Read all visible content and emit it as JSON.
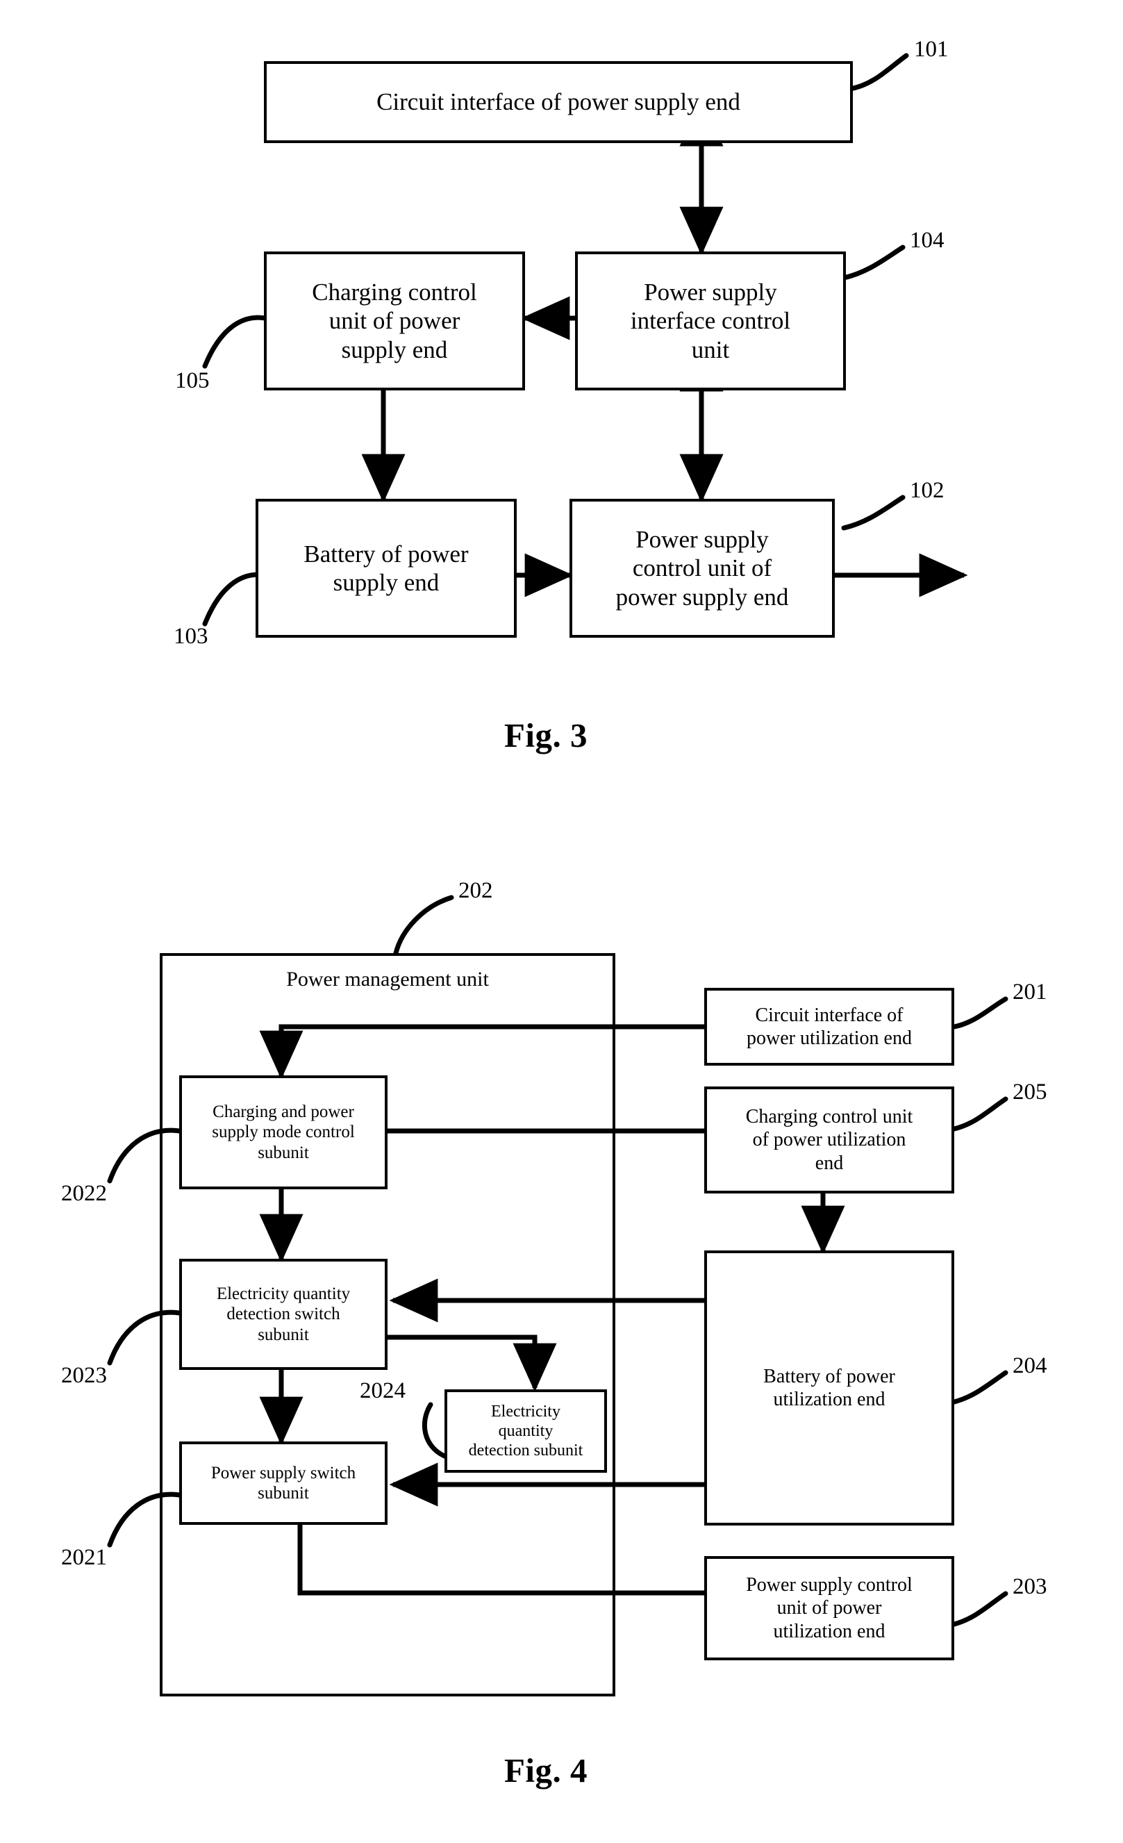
{
  "figure3": {
    "caption": "Fig. 3",
    "boxes": [
      {
        "id": "circuit-interface-power-supply-end",
        "label": "Circuit interface of power supply end",
        "ref": "101"
      },
      {
        "id": "charging-control-unit-power-supply-end",
        "label": "Charging control\nunit of power\nsupply end",
        "ref": "105"
      },
      {
        "id": "power-supply-interface-control-unit",
        "label": "Power supply\ninterface control\nunit",
        "ref": "104"
      },
      {
        "id": "battery-power-supply-end",
        "label": "Battery of power\nsupply end",
        "ref": "103"
      },
      {
        "id": "power-supply-control-unit-power-supply-end",
        "label": "Power supply\ncontrol unit of\npower supply end",
        "ref": "102"
      }
    ],
    "refs": {
      "r101": "101",
      "r102": "102",
      "r103": "103",
      "r104": "104",
      "r105": "105"
    }
  },
  "figure4": {
    "caption": "Fig. 4",
    "container": {
      "title": "Power management unit",
      "ref": "202"
    },
    "boxes": [
      {
        "id": "charging-and-power-supply-mode-control-subunit",
        "label": "Charging and power\nsupply mode control\nsubunit",
        "ref": "2022"
      },
      {
        "id": "electricity-quantity-detection-switch-subunit",
        "label": "Electricity quantity\ndetection switch\nsubunit",
        "ref": "2023"
      },
      {
        "id": "electricity-quantity-detection-subunit",
        "label": "Electricity\nquantity\ndetection subunit",
        "ref": "2024"
      },
      {
        "id": "power-supply-switch-subunit",
        "label": "Power supply switch\nsubunit",
        "ref": "2021"
      },
      {
        "id": "circuit-interface-power-utilization-end",
        "label": "Circuit interface of\npower utilization end",
        "ref": "201"
      },
      {
        "id": "charging-control-unit-power-utilization-end",
        "label": "Charging control unit\nof power utilization\nend",
        "ref": "205"
      },
      {
        "id": "battery-power-utilization-end",
        "label": "Battery of power\nutilization end",
        "ref": "204"
      },
      {
        "id": "power-supply-control-unit-power-utilization-end",
        "label": "Power supply control\nunit of power\nutilization end",
        "ref": "203"
      }
    ],
    "refs": {
      "r201": "201",
      "r202": "202",
      "r203": "203",
      "r204": "204",
      "r205": "205",
      "r2021": "2021",
      "r2022": "2022",
      "r2023": "2023",
      "r2024": "2024"
    }
  },
  "colors": {
    "line": "#000000",
    "background": "#ffffff"
  }
}
